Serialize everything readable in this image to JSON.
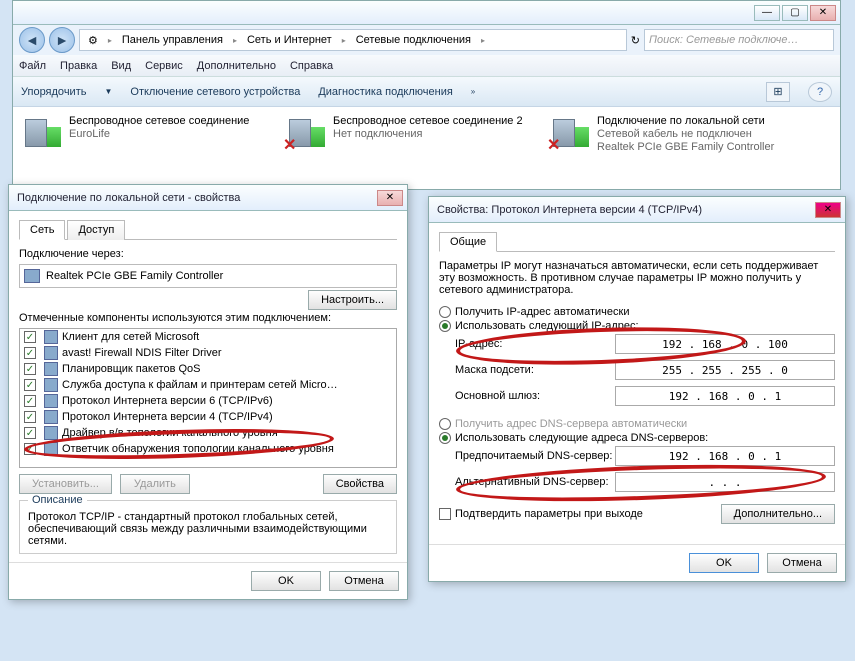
{
  "main": {
    "breadcrumb": [
      "Панель управления",
      "Сеть и Интернет",
      "Сетевые подключения"
    ],
    "search_placeholder": "Поиск: Сетевые подключе…",
    "menus": [
      "Файл",
      "Правка",
      "Вид",
      "Сервис",
      "Дополнительно",
      "Справка"
    ],
    "cmds": {
      "organize": "Упорядочить",
      "disable": "Отключение сетевого устройства",
      "diag": "Диагностика подключения"
    },
    "conns": [
      {
        "name": "Беспроводное сетевое соединение",
        "status": "",
        "adapter": "EuroLife",
        "disabled": false
      },
      {
        "name": "Беспроводное сетевое соединение 2",
        "status": "Нет подключения",
        "adapter": "",
        "disabled": true
      },
      {
        "name": "Подключение по локальной сети",
        "status": "Сетевой кабель не подключен",
        "adapter": "Realtek PCIe GBE Family Controller",
        "disabled": false
      }
    ]
  },
  "props": {
    "title": "Подключение по локальной сети - свойства",
    "tabs": [
      "Сеть",
      "Доступ"
    ],
    "conn_via": "Подключение через:",
    "adapter": "Realtek PCIe GBE Family Controller",
    "configure": "Настроить...",
    "comp_label": "Отмеченные компоненты используются этим подключением:",
    "items": [
      "Клиент для сетей Microsoft",
      "avast! Firewall NDIS Filter Driver",
      "Планировщик пакетов QoS",
      "Служба доступа к файлам и принтерам сетей Micro…",
      "Протокол Интернета версии 6 (TCP/IPv6)",
      "Протокол Интернета версии 4 (TCP/IPv4)",
      "Драйвер в/в топологии канального уровня",
      "Ответчик обнаружения топологии канального уровня"
    ],
    "install": "Установить...",
    "remove": "Удалить",
    "props_btn": "Свойства",
    "desc_h": "Описание",
    "desc": "Протокол TCP/IP - стандартный протокол глобальных сетей, обеспечивающий связь между различными взаимодействующими сетями.",
    "ok": "OK",
    "cancel": "Отмена"
  },
  "ipv4": {
    "title": "Свойства: Протокол Интернета версии 4 (TCP/IPv4)",
    "tab": "Общие",
    "intro": "Параметры IP могут назначаться автоматически, если сеть поддерживает эту возможность. В противном случае параметры IP можно получить у сетевого администратора.",
    "r_auto_ip": "Получить IP-адрес автоматически",
    "r_manual_ip": "Использовать следующий IP-адрес:",
    "ip_label": "IP-адрес:",
    "ip": "192 . 168 .   0 . 100",
    "mask_label": "Маска подсети:",
    "mask": "255 . 255 . 255 .   0",
    "gw_label": "Основной шлюз:",
    "gw": "192 . 168 .   0 .   1",
    "r_auto_dns": "Получить адрес DNS-сервера автоматически",
    "r_manual_dns": "Использовать следующие адреса DNS-серверов:",
    "dns1_label": "Предпочитаемый DNS-сервер:",
    "dns1": "192 . 168 .   0 .   1",
    "dns2_label": "Альтернативный DNS-сервер:",
    "dns2": " .       .       . ",
    "confirm": "Подтвердить параметры при выходе",
    "advanced": "Дополнительно...",
    "ok": "OK",
    "cancel": "Отмена"
  }
}
